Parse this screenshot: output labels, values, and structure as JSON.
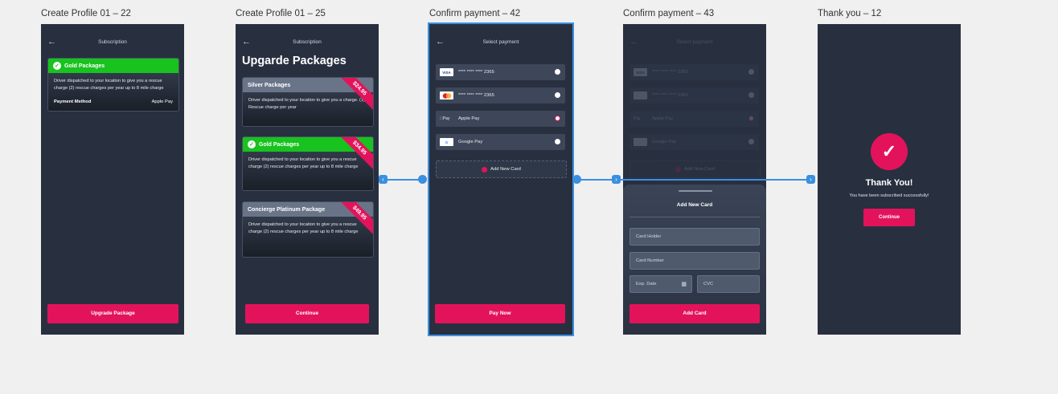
{
  "artboards": [
    {
      "label": "Create Profile 01 – 22"
    },
    {
      "label": "Create Profile 01 – 25"
    },
    {
      "label": "Confirm payment – 42"
    },
    {
      "label": "Confirm payment – 43"
    },
    {
      "label": "Thank you – 12"
    }
  ],
  "s1": {
    "title": "Subscription",
    "card_title": "Gold Packages",
    "card_desc": "Driver dispatched to your location to give you a rescue charge (2) rescue charges per year up to 8 mile charge",
    "pm_label": "Payment Method",
    "pm_value": "Apple Pay",
    "button": "Upgrade Package"
  },
  "s2": {
    "title": "Upgarde Packages",
    "packages": [
      {
        "name": "Silver Packages",
        "desc": "Driver dispatched to your location to give you a charge. (1) Rescue charge per year",
        "price": "$24.95"
      },
      {
        "name": "Gold Packages",
        "desc": "Driver dispatched to your location to give you a rescue charge (2) rescue charges per year up to 8 mile charge",
        "price": "$34.95"
      },
      {
        "name": "Concierge Platinum Package",
        "desc": "Driver dispatched to your location to give you a rescue charge (2) rescue charges per year up to 8 mile charge",
        "price": "$49.95"
      }
    ],
    "button": "Continue"
  },
  "s3": {
    "title": "Select payment",
    "methods": [
      {
        "label": "**** **** **** 2365",
        "logo": "VISA"
      },
      {
        "label": "**** **** **** 2365",
        "logo": "MC"
      },
      {
        "label": "Apple Pay",
        "logo": "Pay"
      },
      {
        "label": "Google Pay",
        "logo": "G"
      }
    ],
    "add_card": "Add New Card",
    "button": "Pay Now"
  },
  "s4": {
    "title": "Select payment",
    "sheet_title": "Add New Card",
    "card_holder": "Card Holder",
    "card_number": "Card Number",
    "exp": "Exp. Date",
    "cvc": "CVC",
    "button": "Add Card"
  },
  "s5": {
    "title": "Thank You!",
    "subtitle": "You have been subscribed successfully!",
    "button": "Continue"
  },
  "colors": {
    "accent": "#e3135b",
    "gold": "#18c21f",
    "screen_bg": "#283040",
    "selection": "#3b8fe0"
  }
}
